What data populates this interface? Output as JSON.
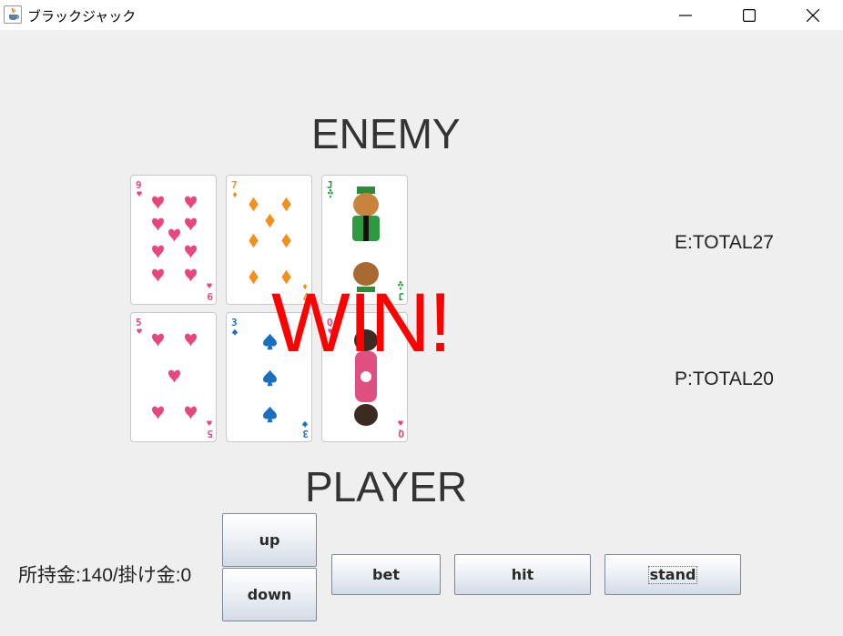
{
  "window": {
    "title": "ブラックジャック",
    "icon": "java-cup-icon"
  },
  "window_controls": [
    "minimize-icon",
    "maximize-icon",
    "close-icon"
  ],
  "enemy": {
    "label": "ENEMY",
    "total": "E:TOTAL27",
    "cards": [
      {
        "rank": "9",
        "suit": "heart",
        "color": "#e8467c"
      },
      {
        "rank": "7",
        "suit": "diamond",
        "color": "#f2901e"
      },
      {
        "rank": "J",
        "suit": "club",
        "color": "#1f9a3a"
      }
    ]
  },
  "player": {
    "label": "PLAYER",
    "total": "P:TOTAL20",
    "cards": [
      {
        "rank": "5",
        "suit": "heart",
        "color": "#e8467c"
      },
      {
        "rank": "3",
        "suit": "spade",
        "color": "#1a6fc0"
      },
      {
        "rank": "Q",
        "suit": "heart",
        "color": "#e8467c"
      }
    ]
  },
  "result": "WIN!",
  "money_status": "所持金:140/掛け金:0",
  "buttons": {
    "up": "up",
    "down": "down",
    "bet": "bet",
    "hit": "hit",
    "stand": "stand"
  },
  "colors": {
    "result": "#ff0000",
    "heart": "#e8467c",
    "diamond": "#f2901e",
    "club": "#1f9a3a",
    "spade": "#1a6fc0"
  }
}
